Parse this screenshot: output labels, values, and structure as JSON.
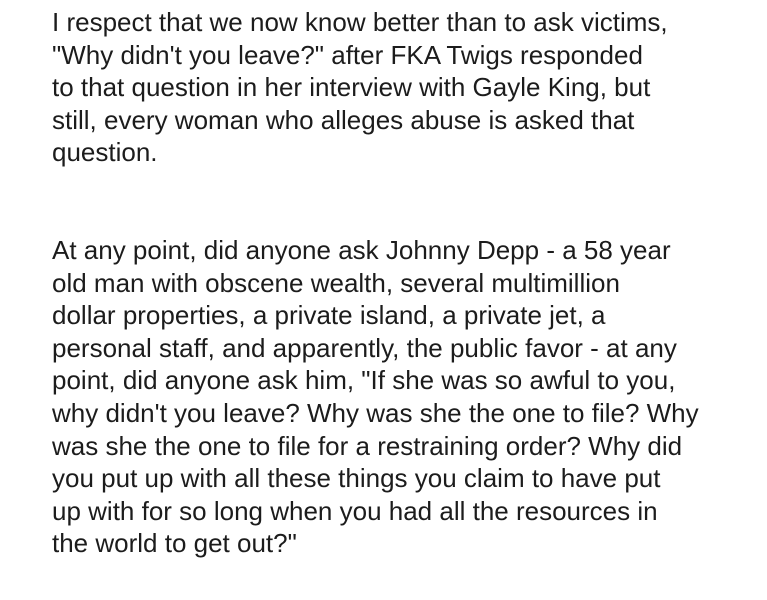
{
  "paragraphs": [
    {
      "lines": [
        "I respect that we now know better than to ask victims,",
        "\"Why didn't you leave?\" after FKA Twigs responded",
        "to that question in her interview with Gayle King, but",
        "still, every woman who alleges abuse is asked that",
        "question."
      ]
    },
    {
      "lines": [
        "At any point, did anyone ask Johnny Depp - a 58 year",
        "old man with obscene wealth, several multimillion",
        "dollar properties, a private island, a private jet, a",
        "personal staff, and apparently, the public favor - at any",
        "point, did anyone ask him, \"If she was so awful to you,",
        "why didn't you leave? Why was she the one to file? Why",
        "was she the one to file for a restraining order? Why did",
        "you put up with all these things you claim to have put",
        "up with for so long when you had all the resources in",
        "the world to get out?\""
      ]
    }
  ]
}
